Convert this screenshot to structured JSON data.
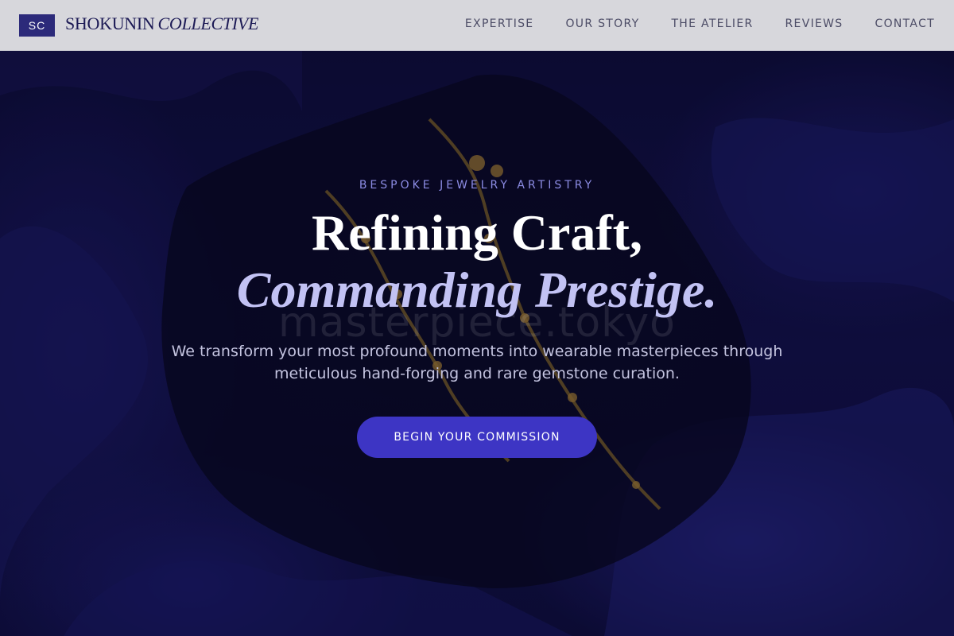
{
  "header": {
    "logo_mark": "SC",
    "brand_main": "SHOKUNIN",
    "brand_italic": "COLLECTIVE",
    "nav": [
      "EXPERTISE",
      "OUR STORY",
      "THE ATELIER",
      "REVIEWS",
      "CONTACT"
    ]
  },
  "hero": {
    "eyebrow": "BESPOKE JEWELRY ARTISTRY",
    "title_line1": "Refining Craft,",
    "title_line2": "Commanding Prestige.",
    "watermark": "masterpiece.tokyo",
    "subtitle": "We transform your most profound moments into wearable masterpieces through meticulous hand-forging and rare gemstone curation.",
    "cta_label": "BEGIN YOUR COMMISSION"
  },
  "colors": {
    "accent": "#3d35c4",
    "brand_dark": "#2c2a7a",
    "eyebrow": "#8c8ce4",
    "title_italic": "#c2c2f4",
    "background": "#0c0b2e"
  }
}
